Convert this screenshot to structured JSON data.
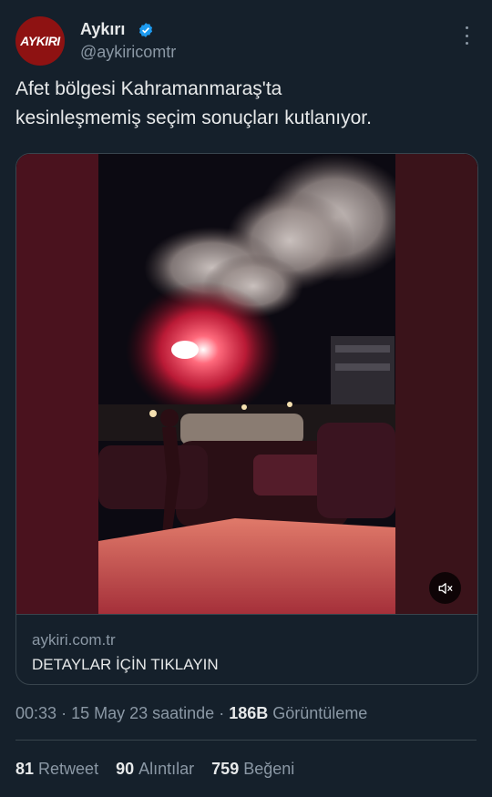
{
  "author": {
    "avatar_text": "AYKIRI",
    "name": "Aykırı",
    "handle": "@aykiricomtr",
    "verified_icon": "verified-badge-icon",
    "colors": {
      "avatar_bg": "#8e1212",
      "verified": "#1d9bf0"
    }
  },
  "tweet": {
    "text_line1": "Afet bölgesi Kahramanmaraş'ta",
    "text_line2": "kesinleşmemiş seçim sonuçları kutlanıyor."
  },
  "card": {
    "media_icon": "mute-icon",
    "domain": "aykiri.com.tr",
    "title": "DETAYLAR İÇİN TIKLAYIN"
  },
  "meta": {
    "time": "00:33",
    "separator1": "·",
    "date": "15 May 23 saatinde",
    "separator2": "·",
    "views_count": "186B",
    "views_label": "Görüntüleme"
  },
  "stats": {
    "retweets_count": "81",
    "retweets_label": "Retweet",
    "quotes_count": "90",
    "quotes_label": "Alıntılar",
    "likes_count": "759",
    "likes_label": "Beğeni"
  }
}
